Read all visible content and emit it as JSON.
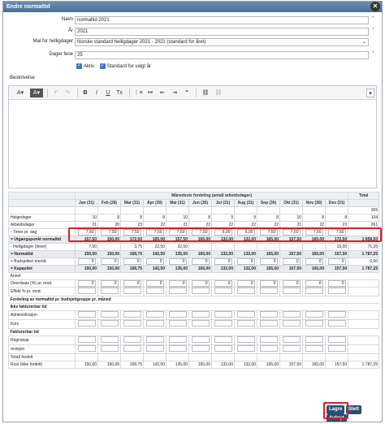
{
  "dialog": {
    "title": "Endre normaltid"
  },
  "form": {
    "name_label": "Navn",
    "name_value": "normaltid 2021",
    "year_label": "År",
    "year_value": "2021",
    "holiday_label": "Mal for helligdager",
    "holiday_value": "Norske standard helligdager 2021 - 2021 (standard for året)",
    "vacation_label": "Dager ferie",
    "vacation_value": "25",
    "active_label": "Aktiv",
    "standard_label": "Standard for valgt år",
    "required_mark": "*",
    "desc_label": "Beskrivelse"
  },
  "table": {
    "group_header": "Månedsvis fordeling (antall arbeidsdager)",
    "total_header": "Total",
    "months": [
      "Jan (31)",
      "Feb (28)",
      "Mar (31)",
      "Apr (30)",
      "Mai (31)",
      "Jun (30)",
      "Jul (31)",
      "Aug (31)",
      "Sep (30)",
      "Okt (31)",
      "Nov (30)",
      "Des (31)"
    ],
    "rows": [
      {
        "label": "",
        "vals": [
          "",
          "",
          "",
          "",
          "",
          "",
          "",
          "",
          "",
          "",
          "",
          ""
        ],
        "total": "365"
      },
      {
        "label": "Helgedager",
        "vals": [
          "10",
          "8",
          "8",
          "8",
          "10",
          "8",
          "9",
          "9",
          "8",
          "10",
          "8",
          "8"
        ],
        "total": "104"
      },
      {
        "label": "Arbeidsdager",
        "vals": [
          "21",
          "20",
          "23",
          "22",
          "21",
          "22",
          "22",
          "22",
          "22",
          "21",
          "22",
          "23"
        ],
        "total": "261"
      },
      {
        "label": "- Timer pr. dag",
        "vals": [
          "7,50",
          "7,50",
          "7,50",
          "7,50",
          "7,50",
          "7,50",
          "6,00",
          "6,00",
          "7,50",
          "7,50",
          "7,50",
          "7,50"
        ],
        "total": ""
      },
      {
        "label": "= Utgangspunkt normaltid",
        "vals": [
          "157,50",
          "150,00",
          "172,50",
          "165,00",
          "157,50",
          "165,00",
          "132,00",
          "132,00",
          "165,00",
          "157,50",
          "165,00",
          "172,50"
        ],
        "total": "1 858,50"
      },
      {
        "label": "- Helligdager (timer)",
        "vals": [
          "7,50",
          "",
          "3,75",
          "22,50",
          "22,50",
          "",
          "",
          "",
          "",
          "",
          "",
          "15,00"
        ],
        "total": "71,25"
      },
      {
        "label": "= Normaltid",
        "vals": [
          "150,00",
          "150,00",
          "168,75",
          "142,50",
          "135,00",
          "165,00",
          "132,00",
          "132,00",
          "165,00",
          "157,50",
          "165,00",
          "157,50"
        ],
        "total": "1 787,25"
      },
      {
        "label": "+ Budsjettert mertid",
        "vals": [
          "0",
          "0",
          "0",
          "0",
          "0",
          "0",
          "0",
          "0",
          "0",
          "0",
          "0",
          "0"
        ],
        "total": "0,00"
      },
      {
        "label": "= Kapasitet",
        "vals": [
          "150,00",
          "150,00",
          "168,75",
          "142,50",
          "135,00",
          "165,00",
          "132,00",
          "132,00",
          "165,00",
          "157,50",
          "165,00",
          "157,50"
        ],
        "total": "1 787,25"
      }
    ],
    "annet_label": "Annet",
    "overdekning_label": "Overdsats (%) pr. mnd.",
    "overdekning_vals": [
      "0",
      "0",
      "0",
      "0",
      "0",
      "0",
      "0",
      "0",
      "0",
      "0",
      "0",
      "0"
    ],
    "effekt_label": "Effekt % pr. mnd.",
    "fordeling_label": "Fordeling av normaltid pr. budsjettgruppe pr. måned",
    "ikke_fakt_label": "Ikke fakturerbar tid",
    "admin_label": "Administrasjon",
    "kurs_label": "Kurs",
    "fakt_label": "Fakturerbar tid",
    "regnskap_label": "Regnskap",
    "revisjon_label": "revisjon",
    "totalt_label": "Totalt fordelt",
    "rest_label": "Rest (ikke fordelt)",
    "rest_vals": [
      "150,00",
      "150,00",
      "168,75",
      "142,50",
      "135,00",
      "165,00",
      "132,00",
      "132,00",
      "165,00",
      "157,50",
      "165,00",
      "157,50"
    ],
    "rest_total": "1 787,25"
  },
  "footer": {
    "save": "Lagre",
    "delete": "Slett",
    "cancel": "Avbryt"
  },
  "colors": {
    "title_bg": "#48709a",
    "highlight": "#d2232a",
    "button": "#2c4d72",
    "checkbox": "#3a79c6"
  }
}
